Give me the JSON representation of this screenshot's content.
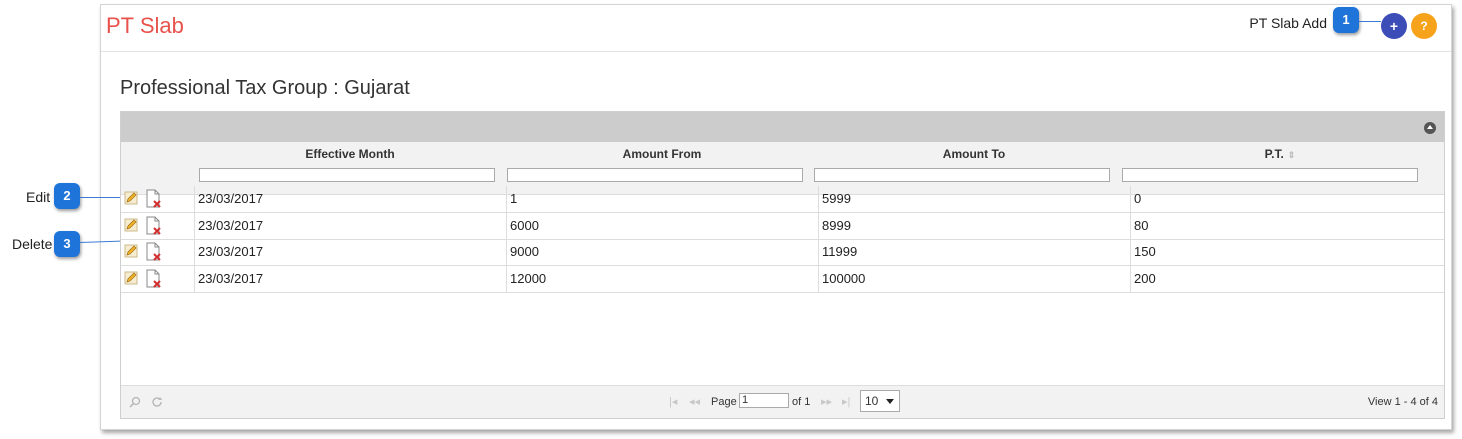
{
  "header": {
    "title": "PT Slab",
    "add_label": "PT Slab Add",
    "add_button": "+",
    "help_button": "?"
  },
  "callouts": [
    {
      "number": "1",
      "text": ""
    },
    {
      "number": "2",
      "text": "Edit"
    },
    {
      "number": "3",
      "text": "Delete"
    }
  ],
  "group_title": "Professional Tax Group : Gujarat",
  "grid": {
    "columns": [
      "Effective Month",
      "Amount From",
      "Amount To",
      "P.T."
    ],
    "rows": [
      [
        "23/03/2017",
        "1",
        "5999",
        "0"
      ],
      [
        "23/03/2017",
        "6000",
        "8999",
        "80"
      ],
      [
        "23/03/2017",
        "9000",
        "11999",
        "150"
      ],
      [
        "23/03/2017",
        "12000",
        "100000",
        "200"
      ]
    ]
  },
  "pager": {
    "page_label": "Page",
    "page_value": "1",
    "of_label": "of 1",
    "rows_per_page": "10",
    "view_text": "View 1 - 4 of 4"
  },
  "icons": {
    "edit": "pencil-edit-icon",
    "delete": "document-delete-icon",
    "search": "search-icon",
    "refresh": "refresh-icon",
    "collapse": "collapse-up-icon"
  },
  "colors": {
    "title": "#e8524c",
    "add_button": "#3d4db7",
    "help_button": "#f7a21b",
    "callout": "#1e74d9"
  }
}
